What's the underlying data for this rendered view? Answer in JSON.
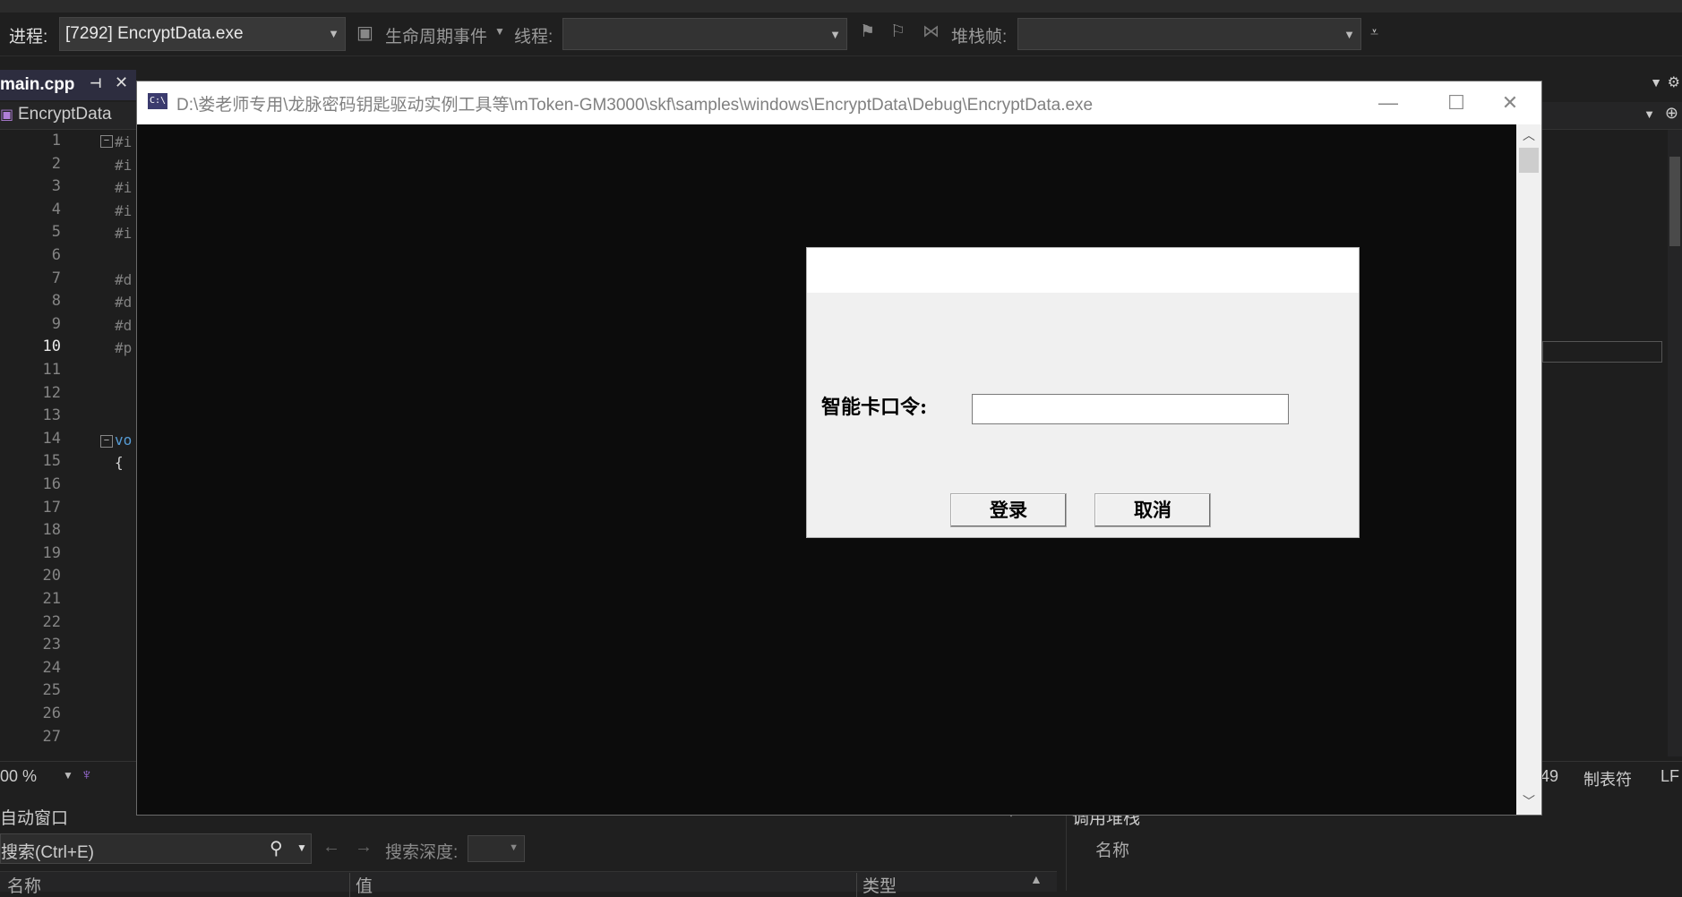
{
  "debug_toolbar": {
    "process_label": "进程:",
    "process_value": "[7292] EncryptData.exe",
    "lifecycle_label": "生命周期事件",
    "thread_label": "线程:",
    "stackframe_label": "堆栈帧:"
  },
  "editor": {
    "tab_title": "main.cpp",
    "nav_project": "EncryptData",
    "line_numbers": [
      "1",
      "2",
      "3",
      "4",
      "5",
      "6",
      "7",
      "8",
      "9",
      "10",
      "11",
      "12",
      "13",
      "14",
      "15",
      "16",
      "17",
      "18",
      "19",
      "20",
      "21",
      "22",
      "23",
      "24",
      "25",
      "26",
      "27"
    ],
    "code_fragments": [
      "#i",
      "#i",
      "#i",
      "#i",
      "#i",
      "",
      "#d",
      "#d",
      "#d",
      "#p",
      "",
      "",
      "",
      "vo",
      "{"
    ],
    "zoom": "00 %",
    "status_pos": "49",
    "status_tabs": "制表符",
    "status_eol": "LF"
  },
  "bottom_panels": {
    "autos_title": "自动窗口",
    "search_placeholder": "搜索(Ctrl+E)",
    "search_depth_label": "搜索深度:",
    "col_name": "名称",
    "col_value": "值",
    "col_type": "类型",
    "callstack_title": "调用堆栈",
    "callstack_col_name": "名称"
  },
  "console": {
    "title": "D:\\娄老师专用\\龙脉密码钥匙驱动实例工具等\\mToken-GM3000\\skf\\samples\\windows\\EncryptData\\Debug\\EncryptData.exe",
    "icon_text": "C:\\"
  },
  "dialog": {
    "pin_label": "智能卡口令:",
    "pin_value": "",
    "login_button": "登录",
    "cancel_button": "取消"
  }
}
